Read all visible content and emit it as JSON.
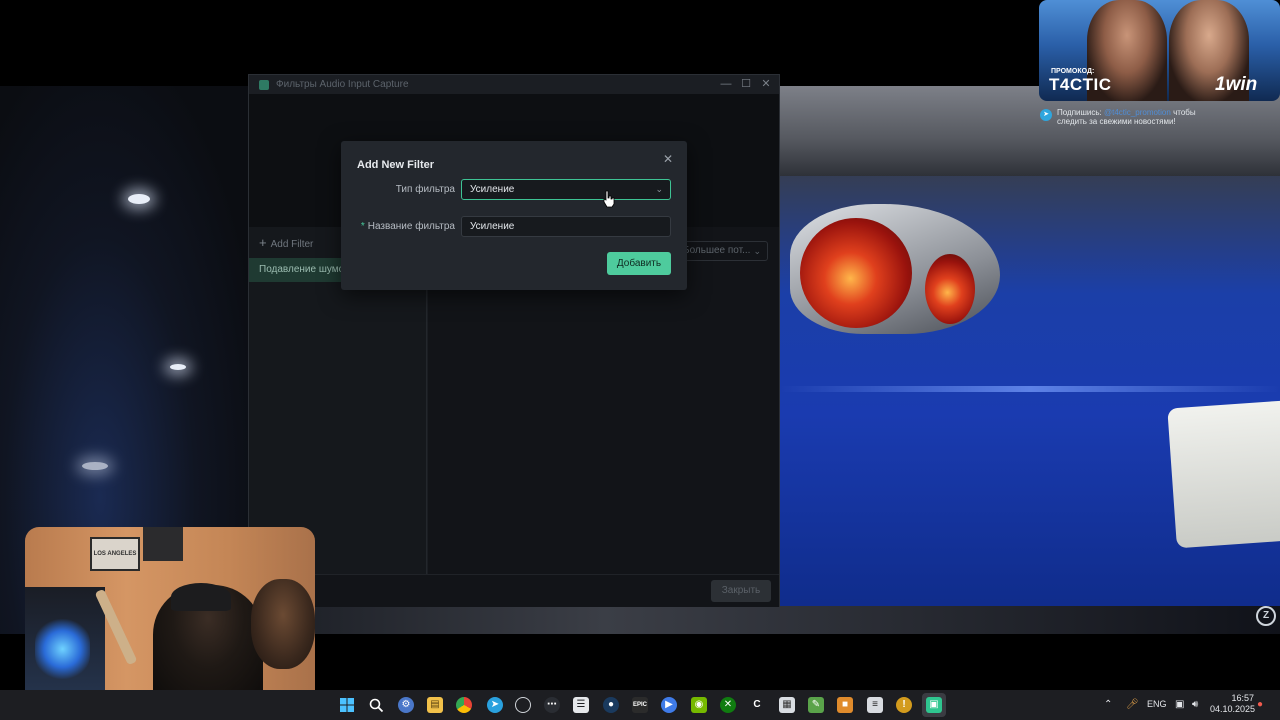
{
  "filters_window": {
    "title": "Фильтры Audio Input Capture",
    "add_filter_label": "Add Filter",
    "filters": [
      "Подавление шумов"
    ],
    "mode_select_value": "Большее пот...",
    "close_label": "Закрыть"
  },
  "add_filter_dialog": {
    "title": "Add New Filter",
    "filter_type_label": "Тип фильтра",
    "filter_type_value": "Усиление",
    "filter_name_label": "Название фильтра",
    "filter_name_value": "Усиление",
    "add_button_label": "Добавить",
    "accent_color": "#4ecb9d"
  },
  "ad": {
    "promo_label": "ПРОМОКОД:",
    "promo_code": "T4CTIC",
    "brand": "1win",
    "caption_prefix": "Подпишись:",
    "caption_handle": "@t4ctic_promotion",
    "caption_suffix": "чтобы",
    "caption_line2": "следить за свежими новостями!"
  },
  "webcam": {
    "poster_text": "LOS ANGELES"
  },
  "taskbar": {
    "language": "ENG",
    "time": "16:57",
    "date": "04.10.2025"
  }
}
